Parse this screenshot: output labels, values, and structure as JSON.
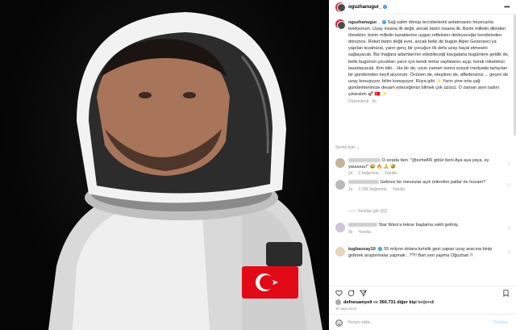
{
  "header": {
    "username": "oguzhanugur_",
    "more_icon": "more-horizontal-icon"
  },
  "caption": {
    "username": "oguzhanugur_",
    "text": "Sağ salim dönüp tecrübelerini anlatmasını heyecanla bekliyorum. Uzay insana ilk değil, ancak bizim insana ilk. Bizim milletin dilinden ötmekler, bizim milletin karakterine uygun refleksler dinleyeceğiz kendisinden dönünce. Roket bizim değil evet, ancak belki de bugün Alper Gezeravcı'ya yapılan tezahürat, yarın genç bir çocuğun ilk defa uzay hayal etmesini sağlayacak. Biz mağara adamlarının edebileceği kavgalarla bugünlere geldik de, belki bugünün çocukları yarın için kendi temiz sayfalarını açıp, kendi roketimizi tasarlayacak. Kim bilir... Ha bir de, uzun zaman sonra sosyal medyada tartışılan bir gündemden keyif alıyorum. Övünen de, eleştiren de, affedersiniz ... geçen de uzay konuşuyor, bilim konuşuyor. Rüya gibi ✨ Yarın yine orta çağ gündemlerimize devam edeceğimizi bilmek çok üzücü. O zaman anın tadını çıkaralım 🚀 🇹🇷 ✨",
    "edited": "Düzenlendi · 9s"
  },
  "sort_label": "Senin için ⌄",
  "comments": [
    {
      "text": "O sırada ben :\"@ezhel06 götür beni Aya aya yaya, ey yauuuuu!\" 😂 🔥 🙏 🤣",
      "age": "2s",
      "likes": "2 beğenme",
      "reply": "Yanıtla"
    },
    {
      "text": "Gelince bir mevzular açık mikrofon patlar mı hocam?",
      "age": "1s",
      "likes": "2.336 beğenme",
      "reply": "Yanıtla",
      "replies": "Yanıtları gör (52)"
    },
    {
      "text": "Star Wars'a tekrar başlama vakti gelmiş.",
      "age": "9s",
      "reply": "Yanıtla"
    },
    {
      "username": "tugbaozay10",
      "text": "55 milyon dolara turistik gezi yapan uzay aracına binip giderek araştırmalar yapmak ..??!! Bari sen yapma Oğuzhan !!",
      "age": ""
    }
  ],
  "likes_line": {
    "user": "defnesamyeli",
    "connector": "ve",
    "count": "360.731 diğer kişi",
    "suffix": "beğendi"
  },
  "ago": "10 saat önce",
  "add_comment": {
    "placeholder": "Yorum ekle...",
    "post": "Paylaş"
  },
  "icons": [
    "heart-icon",
    "comment-icon",
    "share-icon",
    "bookmark-icon",
    "emoji-icon"
  ],
  "colors": {
    "verified": "#3897f0",
    "muted": "#8e8e8e",
    "flag_red": "#e30a17"
  }
}
